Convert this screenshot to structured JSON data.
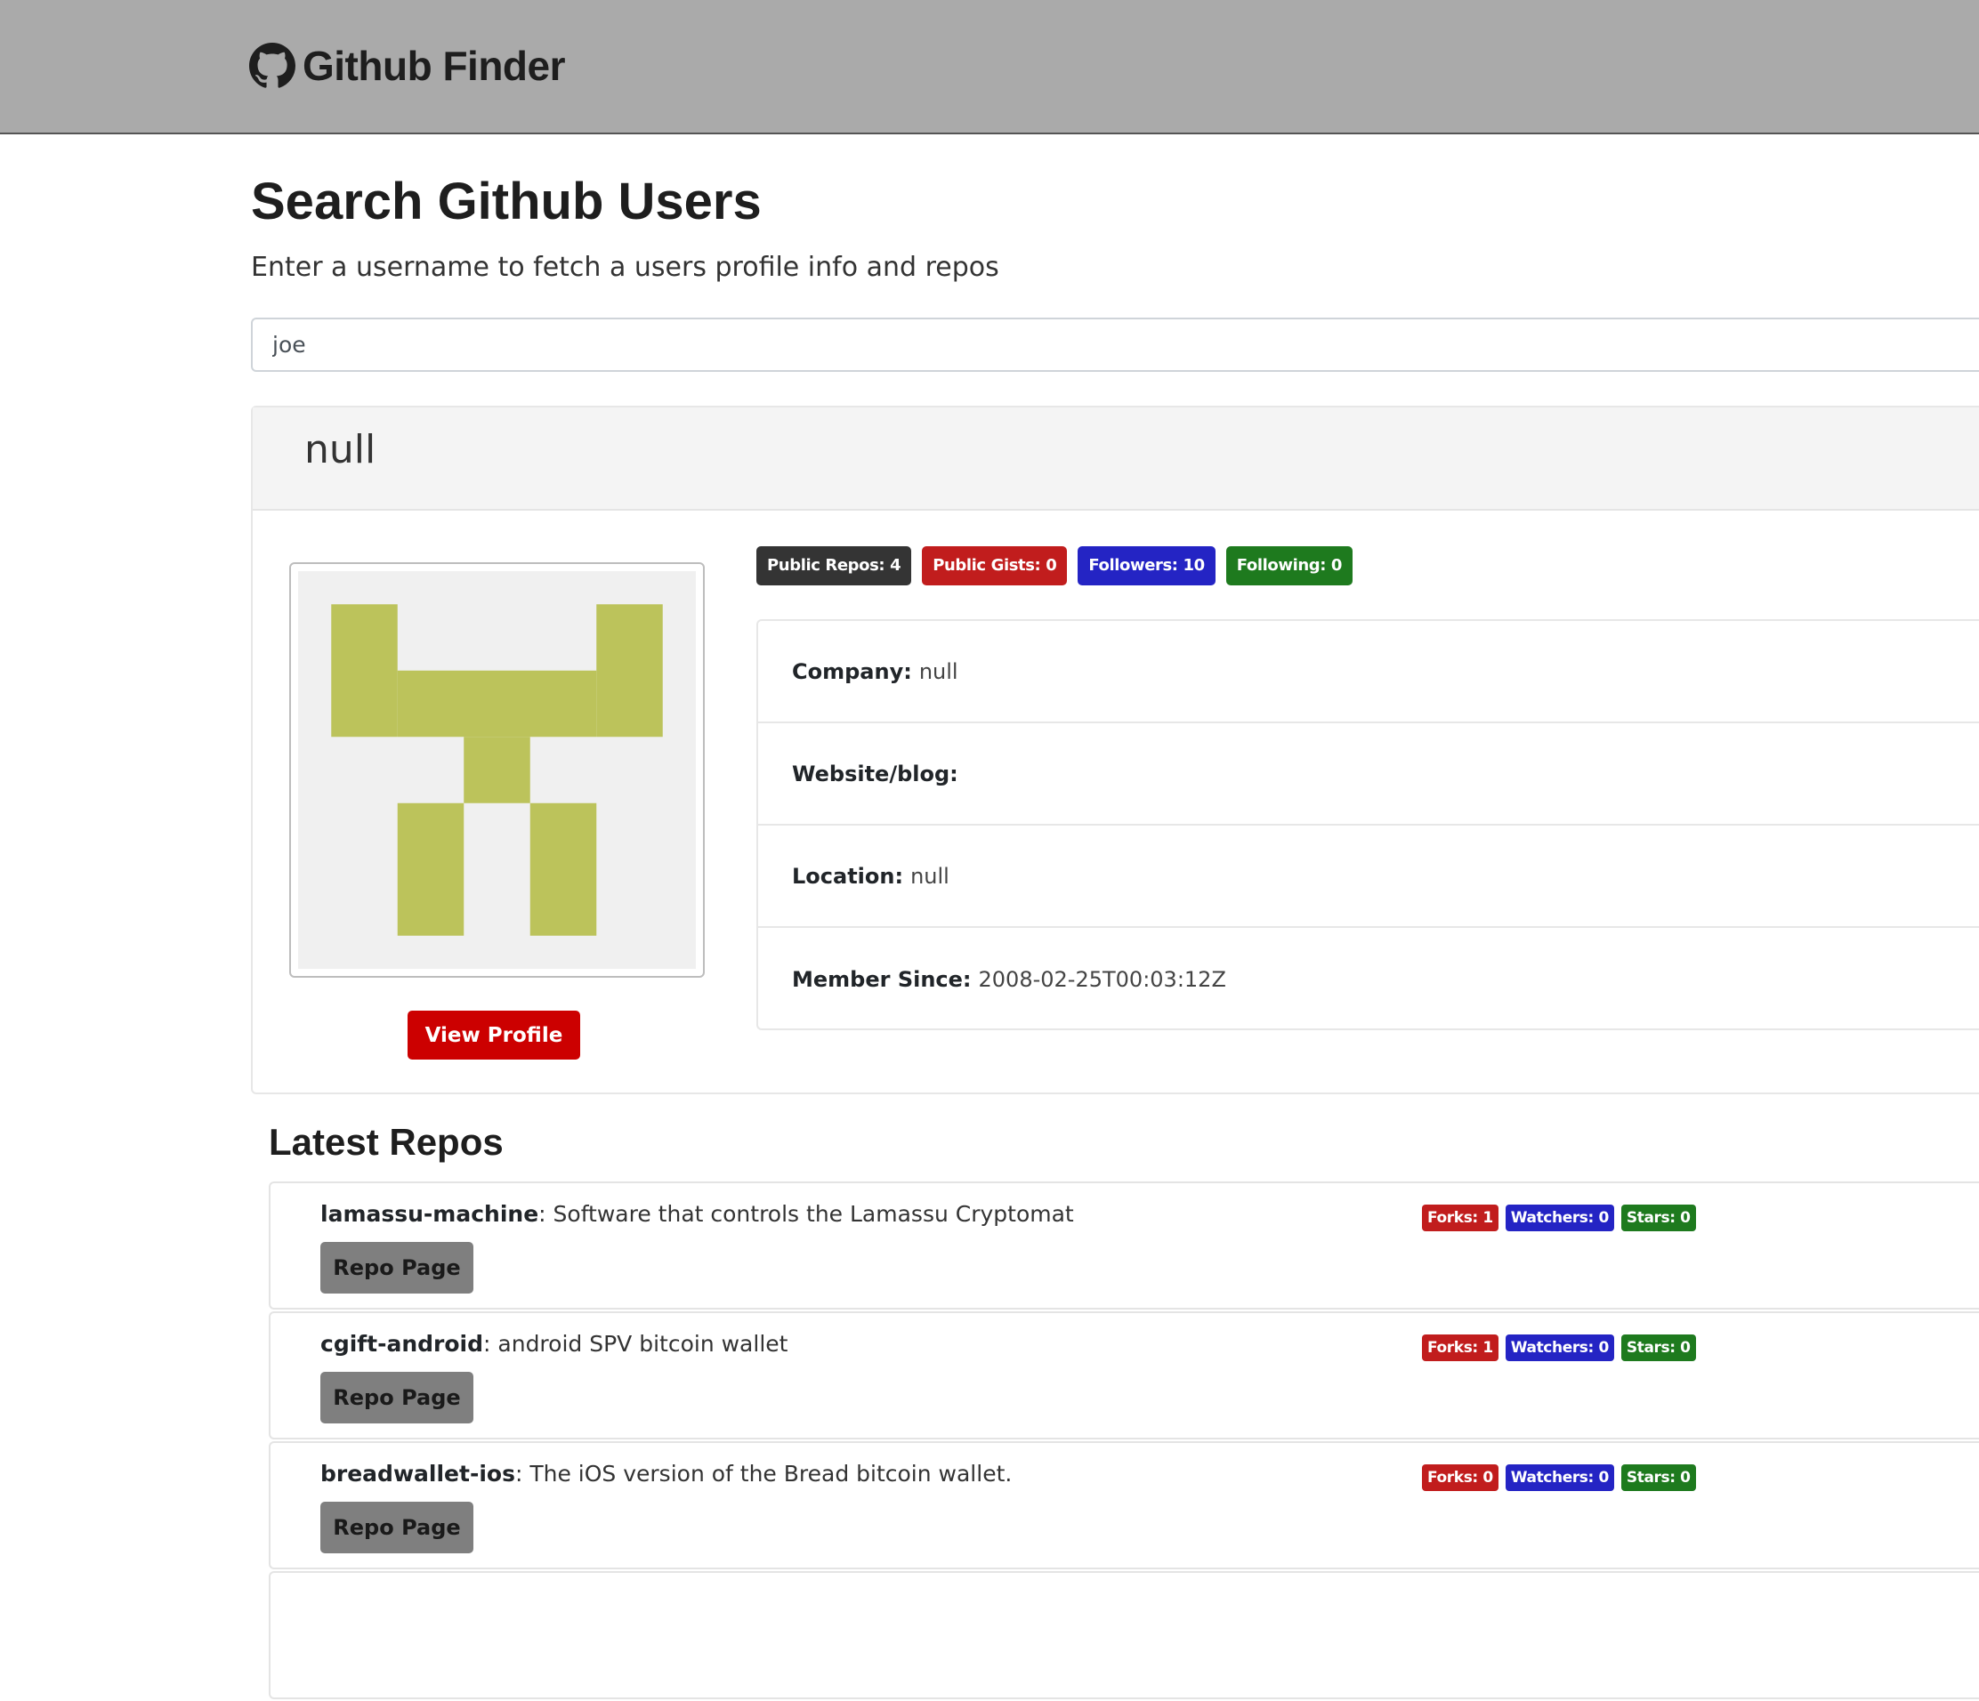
{
  "navbar": {
    "brand": "Github Finder",
    "icon": "github-icon"
  },
  "search": {
    "title": "Search Github Users",
    "subtitle": "Enter a username to fetch a users profile info and repos",
    "value": "joe"
  },
  "profile": {
    "name": "null",
    "avatar_color": "#bcc35b",
    "view_profile_label": "View Profile",
    "badges": {
      "public_repos": "Public Repos: 4",
      "public_gists": "Public Gists: 0",
      "followers": "Followers: 10",
      "following": "Following: 0"
    },
    "company_label": "Company:",
    "company_value": "null",
    "website_label": "Website/blog:",
    "website_value": "",
    "location_label": "Location:",
    "location_value": "null",
    "member_since_label": "Member Since:",
    "member_since_value": "2008-02-25T00:03:12Z"
  },
  "repos": {
    "heading": "Latest Repos",
    "items": [
      {
        "name": "lamassu-machine",
        "description": ": Software that controls the Lamassu Cryptomat",
        "forks": "Forks: 1",
        "watchers": "Watchers: 0",
        "stars": "Stars: 0",
        "button_label": "Repo Page"
      },
      {
        "name": "cgift-android",
        "description": ": android SPV bitcoin wallet",
        "forks": "Forks: 1",
        "watchers": "Watchers: 0",
        "stars": "Stars: 0",
        "button_label": "Repo Page"
      },
      {
        "name": "breadwallet-ios",
        "description": ": The iOS version of the Bread bitcoin wallet.",
        "forks": "Forks: 0",
        "watchers": "Watchers: 0",
        "stars": "Stars: 0",
        "button_label": "Repo Page"
      }
    ]
  },
  "colors": {
    "navbar": "#aaaaaa",
    "badge_dark": "#343434",
    "badge_red": "#c11d1d",
    "badge_blue": "#2424c4",
    "badge_green": "#1e7a1e",
    "view_profile": "#cc0000",
    "repo_button": "#7f7f7f"
  }
}
